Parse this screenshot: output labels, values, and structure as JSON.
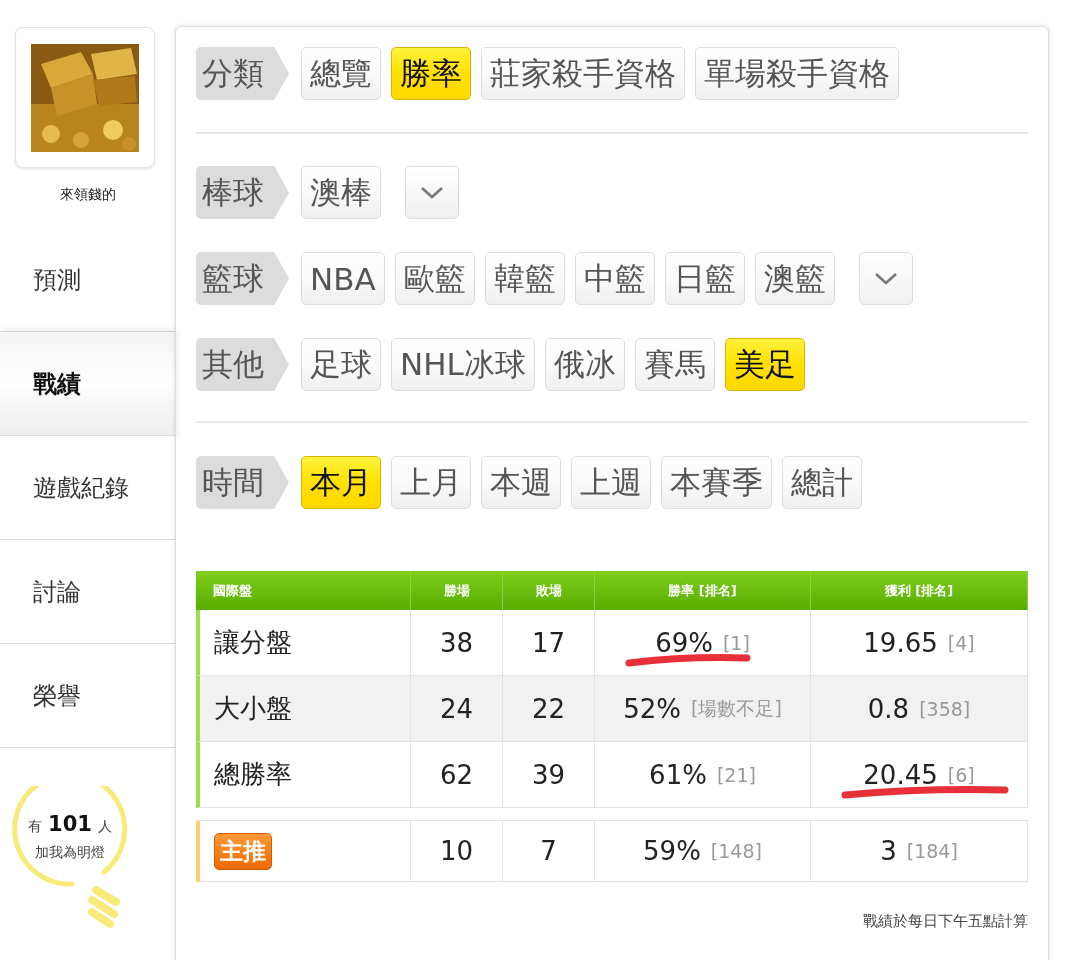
{
  "profile": {
    "name": "來領錢的"
  },
  "sidebar": {
    "items": [
      {
        "label": "預測",
        "selected": false
      },
      {
        "label": "戰績",
        "selected": true
      },
      {
        "label": "遊戲紀錄",
        "selected": false
      },
      {
        "label": "討論",
        "selected": false
      },
      {
        "label": "榮譽",
        "selected": false
      }
    ]
  },
  "fans": {
    "prefix": "有",
    "count": "101",
    "suffix": "人",
    "caption": "加我為明燈"
  },
  "filter_sections": [
    {
      "rows": [
        {
          "label": "分類",
          "more": false,
          "chips": [
            {
              "label": "總覽",
              "selected": false
            },
            {
              "label": "勝率",
              "selected": true
            },
            {
              "label": "莊家殺手資格",
              "selected": false
            },
            {
              "label": "單場殺手資格",
              "selected": false
            }
          ]
        }
      ]
    },
    {
      "rows": [
        {
          "label": "棒球",
          "more": true,
          "chips": [
            {
              "label": "澳棒",
              "selected": false
            }
          ]
        },
        {
          "label": "籃球",
          "more": true,
          "chips": [
            {
              "label": "NBA",
              "selected": false
            },
            {
              "label": "歐籃",
              "selected": false
            },
            {
              "label": "韓籃",
              "selected": false
            },
            {
              "label": "中籃",
              "selected": false
            },
            {
              "label": "日籃",
              "selected": false
            },
            {
              "label": "澳籃",
              "selected": false
            }
          ]
        },
        {
          "label": "其他",
          "more": false,
          "chips": [
            {
              "label": "足球",
              "selected": false
            },
            {
              "label": "NHL冰球",
              "selected": false
            },
            {
              "label": "俄冰",
              "selected": false
            },
            {
              "label": "賽馬",
              "selected": false
            },
            {
              "label": "美足",
              "selected": true
            }
          ]
        }
      ]
    },
    {
      "rows": [
        {
          "label": "時間",
          "more": false,
          "chips": [
            {
              "label": "本月",
              "selected": true
            },
            {
              "label": "上月",
              "selected": false
            },
            {
              "label": "本週",
              "selected": false
            },
            {
              "label": "上週",
              "selected": false
            },
            {
              "label": "本賽季",
              "selected": false
            },
            {
              "label": "總計",
              "selected": false
            }
          ]
        }
      ]
    }
  ],
  "table": {
    "columns": [
      "國際盤",
      "勝場",
      "敗場",
      "勝率 [排名]",
      "獲利 [排名]"
    ],
    "rows": [
      {
        "kind": "market",
        "label": "讓分盤",
        "wins": "38",
        "losses": "17",
        "rate": "69%",
        "rate_rank": "[1]",
        "rate_marked": true,
        "profit": "19.65",
        "profit_rank": "[4]",
        "profit_marked": false
      },
      {
        "kind": "market",
        "label": "大小盤",
        "wins": "24",
        "losses": "22",
        "rate": "52%",
        "rate_rank": "[場數不足]",
        "rate_marked": false,
        "profit": "0.8",
        "profit_rank": "[358]",
        "profit_marked": false
      },
      {
        "kind": "market",
        "label": "總勝率",
        "wins": "62",
        "losses": "39",
        "rate": "61%",
        "rate_rank": "[21]",
        "rate_marked": false,
        "profit": "20.45",
        "profit_rank": "[6]",
        "profit_marked": true
      },
      {
        "kind": "pick",
        "label": "主推",
        "wins": "10",
        "losses": "7",
        "rate": "59%",
        "rate_rank": "[148]",
        "rate_marked": false,
        "profit": "3",
        "profit_rank": "[184]",
        "profit_marked": false
      }
    ]
  },
  "footnote": "戰績於每日下午五點計算"
}
